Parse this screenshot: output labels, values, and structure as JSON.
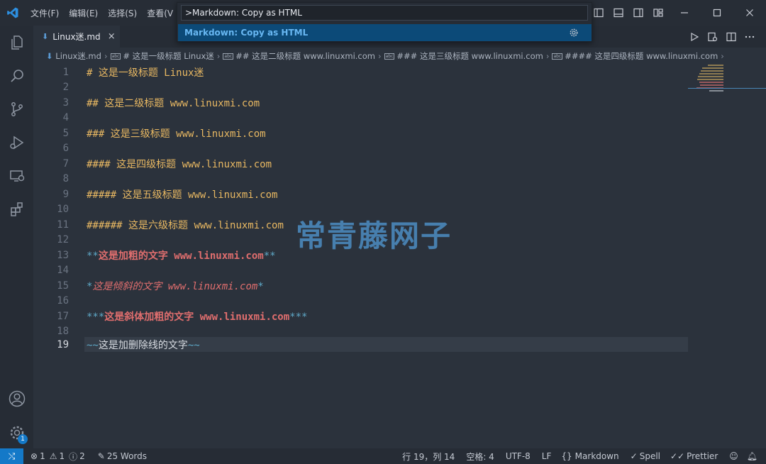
{
  "titlebar": {
    "menus": [
      "文件(F)",
      "编辑(E)",
      "选择(S)",
      "查看(V"
    ]
  },
  "quick_open": {
    "input_value": ">Markdown: Copy as HTML",
    "result_label": "Markdown: Copy as HTML"
  },
  "tab": {
    "label": "Linux迷.md",
    "close_glyph": "×"
  },
  "breadcrumb": [
    "Linux迷.md",
    "# 这是一级标题 Linux迷",
    "## 这是二级标题 www.linuxmi.com",
    "### 这是三级标题 www.linuxmi.com",
    "#### 这是四级标题 www.linuxmi.com"
  ],
  "editor": {
    "current_line": 19,
    "lines": [
      {
        "n": "1",
        "text": "# 这是一级标题 Linux迷"
      },
      {
        "n": "2",
        "text": ""
      },
      {
        "n": "3",
        "text": "## 这是二级标题 www.linuxmi.com"
      },
      {
        "n": "4",
        "text": ""
      },
      {
        "n": "5",
        "text": "### 这是三级标题 www.linuxmi.com"
      },
      {
        "n": "6",
        "text": ""
      },
      {
        "n": "7",
        "text": "#### 这是四级标题 www.linuxmi.com"
      },
      {
        "n": "8",
        "text": ""
      },
      {
        "n": "9",
        "text": "##### 这是五级标题 www.linuxmi.com"
      },
      {
        "n": "10",
        "text": ""
      },
      {
        "n": "11",
        "text": "###### 这是六级标题 www.linuxmi.com"
      },
      {
        "n": "12",
        "text": ""
      },
      {
        "n": "13",
        "text": "**这是加粗的文字 www.linuxmi.com**"
      },
      {
        "n": "14",
        "text": ""
      },
      {
        "n": "15",
        "text": "*这是倾斜的文字 www.linuxmi.com*"
      },
      {
        "n": "16",
        "text": ""
      },
      {
        "n": "17",
        "text": "***这是斜体加粗的文字 www.linuxmi.com***"
      },
      {
        "n": "18",
        "text": ""
      },
      {
        "n": "19",
        "text": "~~这是加删除线的文字~~"
      }
    ],
    "segments": {
      "l1": [
        "# ",
        "这是一级标题 Linux迷"
      ],
      "l3": [
        "## ",
        "这是二级标题 www.linuxmi.com"
      ],
      "l5": [
        "### ",
        "这是三级标题 www.linuxmi.com"
      ],
      "l7": [
        "#### ",
        "这是四级标题 www.linuxmi.com"
      ],
      "l9": [
        "##### ",
        "这是五级标题 www.linuxmi.com"
      ],
      "l11": [
        "###### ",
        "这是六级标题 www.linuxmi.com"
      ],
      "l13": [
        "**",
        "这是加粗的文字 www.linuxmi.com",
        "**"
      ],
      "l15": [
        "*",
        "这是倾斜的文字 www.linuxmi.com",
        "*"
      ],
      "l17": [
        "***",
        "这是斜体加粗的文字 www.linuxmi.com",
        "***"
      ],
      "l19": [
        "~~",
        "这是加删除线的文字",
        "~~"
      ]
    }
  },
  "watermark": "常青藤网子",
  "statusbar": {
    "errors": "1",
    "warnings": "1",
    "infos": "2",
    "words": "25 Words",
    "position": "行 19，列 14",
    "spaces": "空格: 4",
    "encoding": "UTF-8",
    "eol": "LF",
    "language": "Markdown",
    "spell": "Spell",
    "prettier": "Prettier"
  },
  "activity_badge": "1",
  "colors": {
    "accent": "#1479c8",
    "heading": "#e8b862",
    "emphasis": "#e06e6e",
    "markup": "#5fa9c8"
  }
}
